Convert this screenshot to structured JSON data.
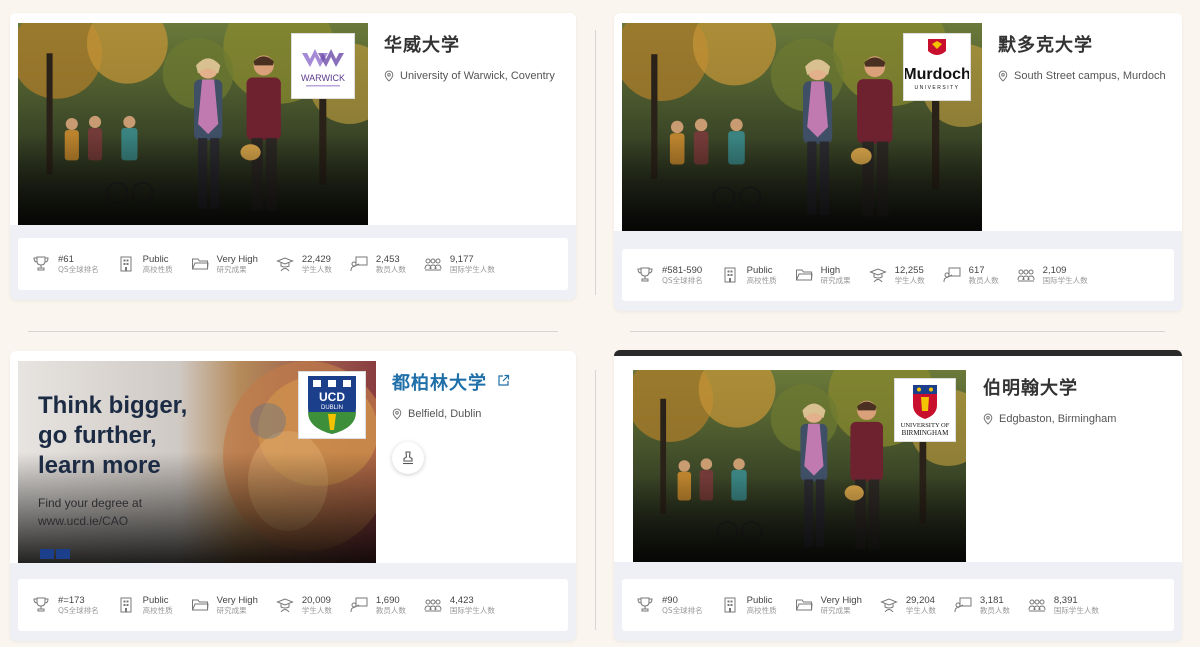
{
  "cards": [
    {
      "name": "华威大学",
      "location": "University of Warwick, Coventry",
      "logo_text": "WARWICK",
      "stats": [
        {
          "value": "#61",
          "label": "QS全球排名"
        },
        {
          "value": "Public",
          "label": "高校性质"
        },
        {
          "value": "Very High",
          "label": "研究成果"
        },
        {
          "value": "22,429",
          "label": "学生人数"
        },
        {
          "value": "2,453",
          "label": "教员人数"
        },
        {
          "value": "9,177",
          "label": "国际学生人数"
        }
      ]
    },
    {
      "name": "默多克大学",
      "location": "South Street campus, Murdoch",
      "logo_text": "Murdoch",
      "logo_sub": "UNIVERSITY",
      "stats": [
        {
          "value": "#581-590",
          "label": "QS全球排名"
        },
        {
          "value": "Public",
          "label": "高校性质"
        },
        {
          "value": "High",
          "label": "研究成果"
        },
        {
          "value": "12,255",
          "label": "学生人数"
        },
        {
          "value": "617",
          "label": "教员人数"
        },
        {
          "value": "2,109",
          "label": "国际学生人数"
        }
      ]
    },
    {
      "name": "都柏林大学",
      "location": "Belfield, Dublin",
      "logo_text": "UCD",
      "logo_sub": "DUBLIN",
      "banner": {
        "line1": "Think bigger,",
        "line2": "go further,",
        "line3": "learn more",
        "sub1": "Find your degree at",
        "sub2": "www.ucd.ie/CAO"
      },
      "stats": [
        {
          "value": "#=173",
          "label": "QS全球排名"
        },
        {
          "value": "Public",
          "label": "高校性质"
        },
        {
          "value": "Very High",
          "label": "研究成果"
        },
        {
          "value": "20,009",
          "label": "学生人数"
        },
        {
          "value": "1,690",
          "label": "教员人数"
        },
        {
          "value": "4,423",
          "label": "国际学生人数"
        }
      ]
    },
    {
      "name": "伯明翰大学",
      "location": "Edgbaston, Birmingham",
      "logo_text": "UNIVERSITY OF",
      "logo_sub": "BIRMINGHAM",
      "stats": [
        {
          "value": "#90",
          "label": "QS全球排名"
        },
        {
          "value": "Public",
          "label": "高校性质"
        },
        {
          "value": "Very High",
          "label": "研究成果"
        },
        {
          "value": "29,204",
          "label": "学生人数"
        },
        {
          "value": "3,181",
          "label": "教员人数"
        },
        {
          "value": "8,391",
          "label": "国际学生人数"
        }
      ]
    }
  ],
  "colors": {
    "page_bg": "#faf5ee",
    "link": "#1f6fa8",
    "warwick_purple": "#5b3a8e",
    "murdoch_red": "#c8102e",
    "ucd_blue": "#1b3f8b",
    "ucd_green": "#3d8f3a"
  },
  "icons": [
    "trophy-icon",
    "building-icon",
    "folder-icon",
    "graduate-icon",
    "teacher-icon",
    "group-icon",
    "pin-icon",
    "external-link-icon",
    "stamp-icon"
  ]
}
